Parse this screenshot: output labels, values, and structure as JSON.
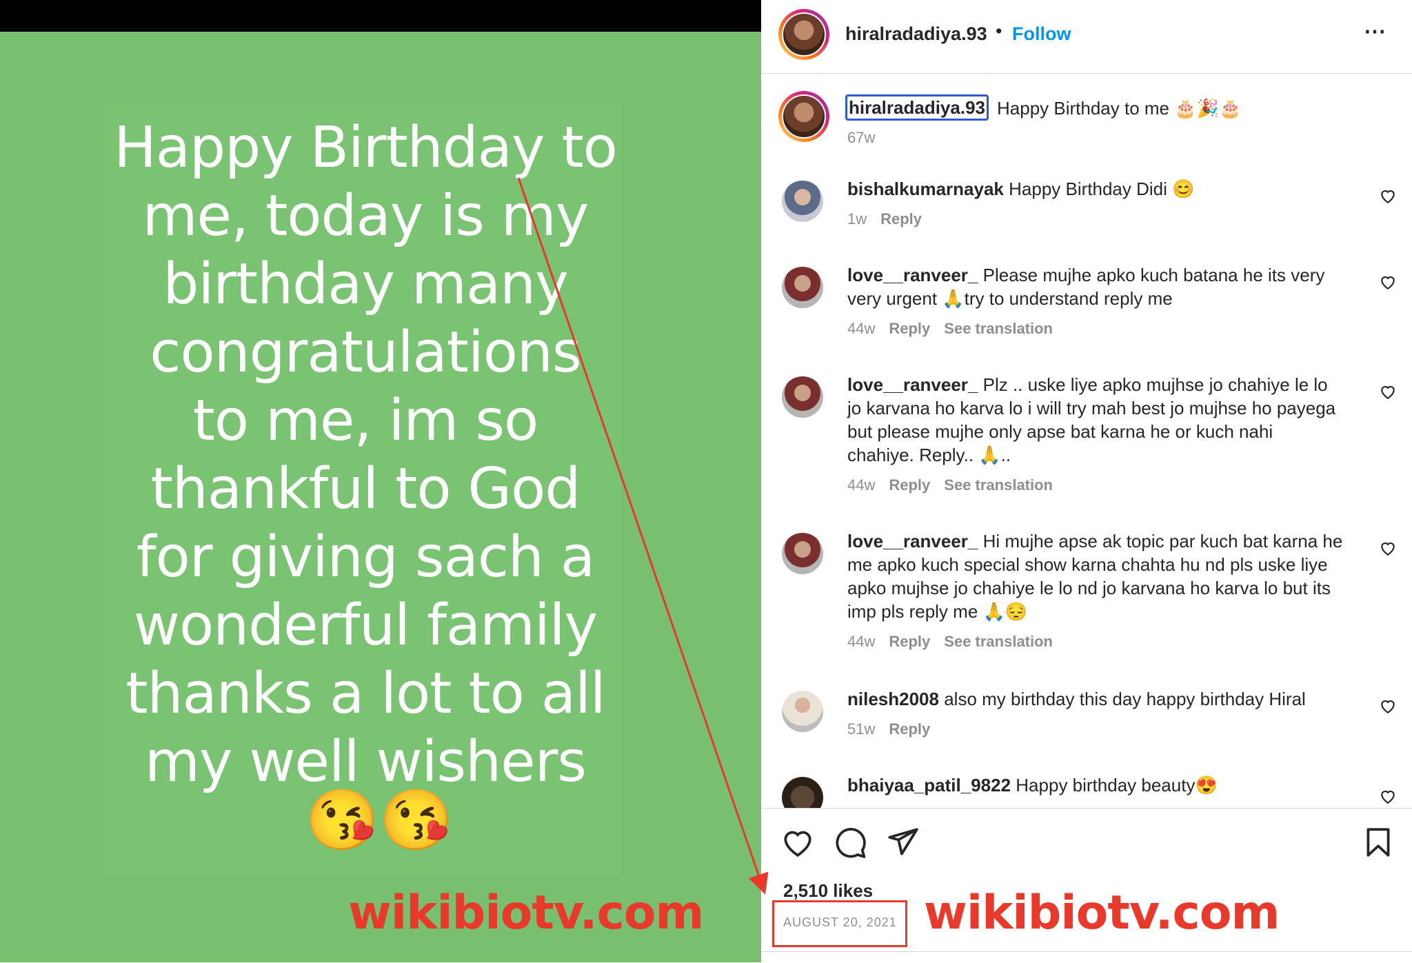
{
  "story": {
    "text": "Happy Birthday to\nme, today is my\nbirthday many\ncongratulations\nto me, im so\nthankful  to God\nfor giving sach a\nwonderful family\nthanks a lot to all\nmy well wishers",
    "emoji": "😘😘"
  },
  "watermark": "wikibiotv.com",
  "post": {
    "username": "hiralradadiya.93",
    "dot": "•",
    "follow_label": "Follow",
    "more_icon": "more-options-icon",
    "caption": {
      "username": "hiralradadiya.93",
      "text": "Happy Birthday to me 🎂🎉🎂",
      "time": "67w"
    },
    "comments": [
      {
        "user": "bishalkumarnayak",
        "text": "Happy Birthday Didi 😊",
        "time": "1w",
        "reply": "Reply",
        "translation": ""
      },
      {
        "user": "love__ranveer_",
        "text": "Please mujhe apko kuch batana he its very very urgent 🙏try to understand reply me",
        "time": "44w",
        "reply": "Reply",
        "translation": "See translation"
      },
      {
        "user": "love__ranveer_",
        "text": "Plz .. uske liye apko mujhse jo chahiye le lo jo karvana ho karva lo i will try mah best jo mujhse ho payega but please mujhe only apse bat karna he or kuch nahi chahiye. Reply.. 🙏..",
        "time": "44w",
        "reply": "Reply",
        "translation": "See translation"
      },
      {
        "user": "love__ranveer_",
        "text": "Hi mujhe apse ak topic par kuch bat karna he me apko kuch special show karna chahta hu nd pls uske liye apko mujhse jo chahiye le lo nd jo karvana ho karva lo but its imp pls reply me 🙏😔",
        "time": "44w",
        "reply": "Reply",
        "translation": "See translation"
      },
      {
        "user": "nilesh2008",
        "text": "also my birthday this day happy birthday Hiral",
        "time": "51w",
        "reply": "Reply",
        "translation": ""
      },
      {
        "user": "bhaiyaa_patil_9822",
        "text": "Happy birthday beauty😍",
        "time": "",
        "reply": "",
        "translation": ""
      }
    ],
    "likes": "2,510 likes",
    "date": "AUGUST 20, 2021"
  },
  "colors": {
    "story_bg": "#78bf70",
    "follow": "#0095f6",
    "annotation": "#e8392b"
  }
}
